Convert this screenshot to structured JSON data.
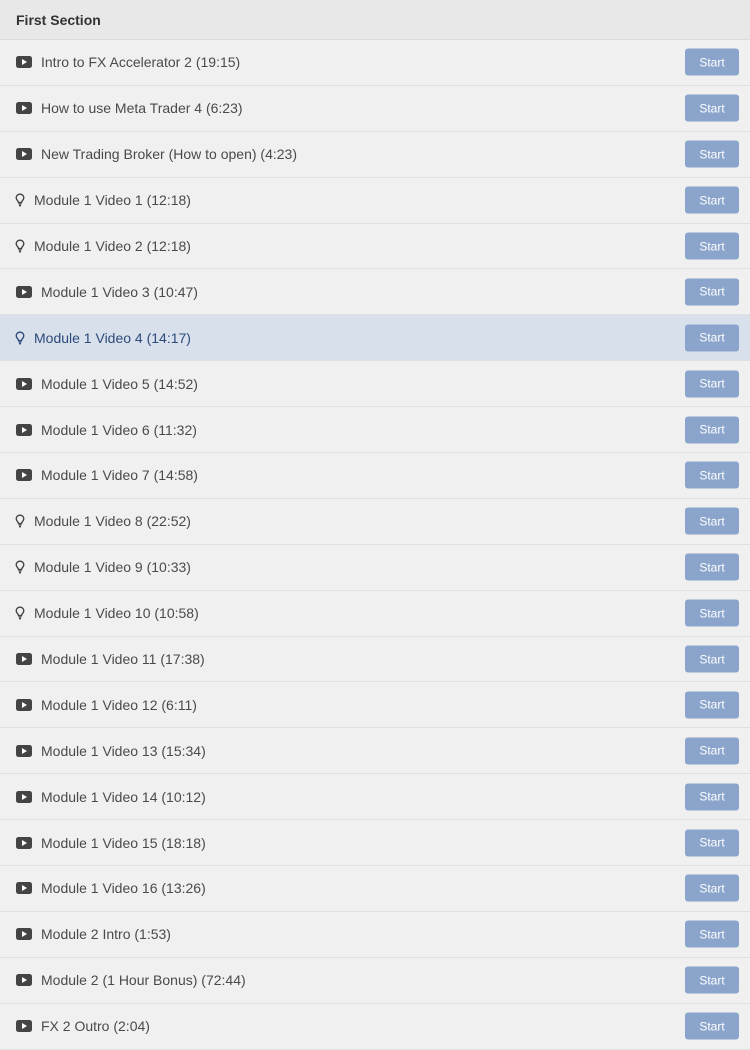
{
  "section": {
    "title": "First Section"
  },
  "button_label": "Start",
  "colors": {
    "background": "#f0f0f0",
    "header_background": "#e8e8e8",
    "active_row": "#d8e0ec",
    "start_button": "#8aa4cc",
    "icon": "#444444"
  },
  "lectures": [
    {
      "title": "Intro to FX Accelerator 2 (19:15)",
      "icon": "play-icon",
      "active": false
    },
    {
      "title": "How to use Meta Trader 4 (6:23)",
      "icon": "play-icon",
      "active": false
    },
    {
      "title": "New Trading Broker (How to open) (4:23)",
      "icon": "play-icon",
      "active": false
    },
    {
      "title": "Module 1 Video 1 (12:18)",
      "icon": "lightbulb-icon",
      "active": false
    },
    {
      "title": "Module 1 Video 2 (12:18)",
      "icon": "lightbulb-icon",
      "active": false
    },
    {
      "title": "Module 1 Video 3 (10:47)",
      "icon": "play-icon",
      "active": false
    },
    {
      "title": "Module 1 Video 4 (14:17)",
      "icon": "lightbulb-icon",
      "active": true
    },
    {
      "title": "Module 1 Video 5 (14:52)",
      "icon": "play-icon",
      "active": false
    },
    {
      "title": "Module 1 Video 6 (11:32)",
      "icon": "play-icon",
      "active": false
    },
    {
      "title": "Module 1 Video 7 (14:58)",
      "icon": "play-icon",
      "active": false
    },
    {
      "title": "Module 1 Video 8 (22:52)",
      "icon": "lightbulb-icon",
      "active": false
    },
    {
      "title": "Module 1 Video 9 (10:33)",
      "icon": "lightbulb-icon",
      "active": false
    },
    {
      "title": "Module 1 Video 10 (10:58)",
      "icon": "lightbulb-icon",
      "active": false
    },
    {
      "title": "Module 1 Video 11 (17:38)",
      "icon": "play-icon",
      "active": false
    },
    {
      "title": "Module 1 Video 12 (6:11)",
      "icon": "play-icon",
      "active": false
    },
    {
      "title": "Module 1 Video 13 (15:34)",
      "icon": "play-icon",
      "active": false
    },
    {
      "title": "Module 1 Video 14 (10:12)",
      "icon": "play-icon",
      "active": false
    },
    {
      "title": "Module 1 Video 15 (18:18)",
      "icon": "play-icon",
      "active": false
    },
    {
      "title": "Module 1 Video 16 (13:26)",
      "icon": "play-icon",
      "active": false
    },
    {
      "title": "Module 2 Intro (1:53)",
      "icon": "play-icon",
      "active": false
    },
    {
      "title": "Module 2 (1 Hour Bonus) (72:44)",
      "icon": "play-icon",
      "active": false
    },
    {
      "title": "FX 2 Outro (2:04)",
      "icon": "play-icon",
      "active": false
    }
  ]
}
